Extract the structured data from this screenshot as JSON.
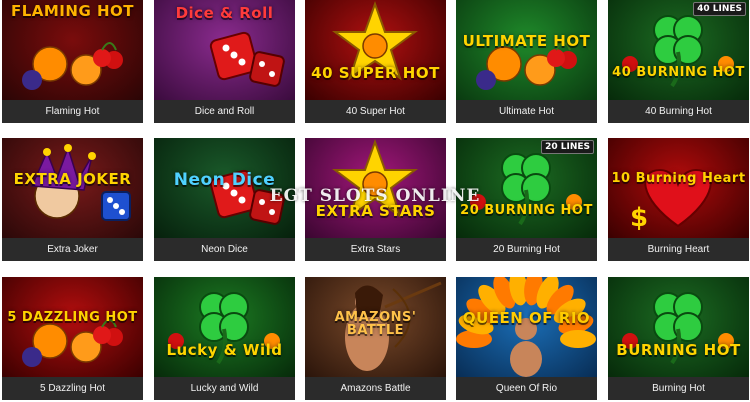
{
  "games": [
    {
      "caption": "Flaming Hot",
      "art": "FLAMING HOT",
      "bg": [
        "#7a0c0c",
        "#2a0505"
      ],
      "accent": "#ffb300",
      "motif": "fruit"
    },
    {
      "caption": "Dice and Roll",
      "art": "Dice & Roll",
      "bg": [
        "#8a2b8e",
        "#3a0b3d"
      ],
      "accent": "#ff3b3b",
      "motif": "dice"
    },
    {
      "caption": "40 Super Hot",
      "art": "40 SUPER HOT",
      "bg": [
        "#b01010",
        "#3a0000"
      ],
      "accent": "#ffd400",
      "motif": "star"
    },
    {
      "caption": "Ultimate Hot",
      "art": "ULTIMATE HOT",
      "bg": [
        "#1f8a2a",
        "#0a3a10"
      ],
      "accent": "#ffd400",
      "motif": "fruit"
    },
    {
      "caption": "40 Burning Hot",
      "art": "40 BURNING HOT",
      "bg": [
        "#1c6b22",
        "#062a0a"
      ],
      "accent": "#ffd400",
      "motif": "clover",
      "badge": "40 LINES"
    },
    {
      "caption": "Extra Joker",
      "art": "EXTRA JOKER",
      "bg": [
        "#7a1a1a",
        "#2a0808"
      ],
      "accent": "#ffd400",
      "motif": "joker"
    },
    {
      "caption": "Neon Dice",
      "art": "Neon Dice",
      "bg": [
        "#1a5a2a",
        "#06200c"
      ],
      "accent": "#4fd1ff",
      "motif": "dice"
    },
    {
      "caption": "Extra Stars",
      "art": "EXTRA STARS",
      "bg": [
        "#a2177a",
        "#3a0630"
      ],
      "accent": "#ffd400",
      "motif": "star"
    },
    {
      "caption": "20 Burning Hot",
      "art": "20 BURNING HOT",
      "bg": [
        "#1c6b22",
        "#062a0a"
      ],
      "accent": "#ffd400",
      "motif": "clover",
      "badge": "20 LINES"
    },
    {
      "caption": "Burning Heart",
      "art": "10 Burning Heart",
      "bg": [
        "#b00b0b",
        "#3a0000"
      ],
      "accent": "#ffd400",
      "motif": "heart"
    },
    {
      "caption": "5 Dazzling Hot",
      "art": "5 DAZZLING HOT",
      "bg": [
        "#b30e0e",
        "#3a0000"
      ],
      "accent": "#ffd400",
      "motif": "fruit"
    },
    {
      "caption": "Lucky and Wild",
      "art": "Lucky & Wild",
      "bg": [
        "#1c7a22",
        "#062a0a"
      ],
      "accent": "#ffd400",
      "motif": "clover"
    },
    {
      "caption": "Amazons Battle",
      "art": "AMAZONS' BATTLE",
      "bg": [
        "#7a4a2a",
        "#2a140a"
      ],
      "accent": "#ffc24a",
      "motif": "warrior"
    },
    {
      "caption": "Queen Of Rio",
      "art": "QUEEN OF RIO",
      "bg": [
        "#1b6fb8",
        "#082d55"
      ],
      "accent": "#ffcc00",
      "motif": "feather"
    },
    {
      "caption": "Burning Hot",
      "art": "BURNING HOT",
      "bg": [
        "#1c6b22",
        "#062a0a"
      ],
      "accent": "#ffd400",
      "motif": "clover"
    }
  ],
  "watermark": "EGT SLOTS ONLINE"
}
